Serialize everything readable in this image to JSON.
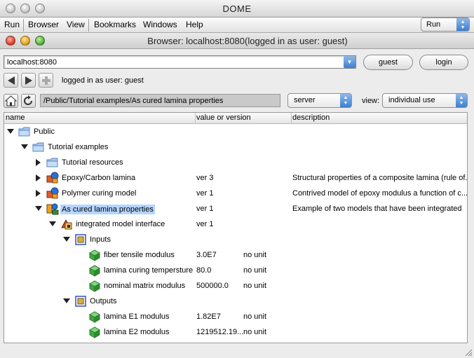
{
  "app": {
    "title": "DOME",
    "menu": [
      "Run",
      "Browser",
      "View",
      "Bookmarks",
      "Windows",
      "Help"
    ],
    "run_select": "Run"
  },
  "browser": {
    "title": "Browser: localhost:8080(logged in as user: guest)",
    "url": "localhost:8080",
    "user_button": "guest",
    "login_button": "login",
    "status": "logged in as user: guest",
    "path": "/Public/Tutorial examples/As cured lamina properties",
    "server_select": "server",
    "view_label": "view:",
    "view_select": "individual use"
  },
  "table": {
    "headers": {
      "name": "name",
      "value": "value or version",
      "description": "description"
    },
    "rows": [
      {
        "name": "Public",
        "value": "",
        "unit": "",
        "description": "",
        "icon": "folder-icon",
        "toggle": "expanded"
      },
      {
        "name": "Tutorial examples",
        "value": "",
        "unit": "",
        "description": "",
        "icon": "folder-icon",
        "toggle": "expanded"
      },
      {
        "name": "Tutorial resources",
        "value": "",
        "unit": "",
        "description": "",
        "icon": "folder-icon",
        "toggle": "collapsed"
      },
      {
        "name": "Epoxy/Carbon lamina",
        "value": "ver 3",
        "unit": "",
        "description": "Structural properties of a composite lamina (rule of...",
        "icon": "model-icon",
        "toggle": "collapsed"
      },
      {
        "name": "Polymer curing model",
        "value": "ver 1",
        "unit": "",
        "description": "Contrived model  of epoxy modulus a function of c...",
        "icon": "model-icon",
        "toggle": "collapsed"
      },
      {
        "name": "As cured lamina properties",
        "value": "ver 1",
        "unit": "",
        "description": "Example of two models that have been integrated",
        "icon": "integrated-model-icon",
        "toggle": "expanded",
        "selected": true
      },
      {
        "name": "integrated model interface",
        "value": "ver 1",
        "unit": "",
        "description": "",
        "icon": "interface-icon",
        "toggle": "expanded"
      },
      {
        "name": "Inputs",
        "value": "",
        "unit": "",
        "description": "",
        "icon": "inputs-group-icon",
        "toggle": "expanded"
      },
      {
        "name": "fiber tensile modulus",
        "value": "3.0E7",
        "unit": "no unit",
        "description": "",
        "icon": "parameter-cube-icon",
        "toggle": "none"
      },
      {
        "name": "lamina curing tempersture",
        "value": "80.0",
        "unit": "no unit",
        "description": "",
        "icon": "parameter-cube-icon",
        "toggle": "none"
      },
      {
        "name": "nominal matrix modulus",
        "value": "500000.0",
        "unit": "no unit",
        "description": "",
        "icon": "parameter-cube-icon",
        "toggle": "none"
      },
      {
        "name": "Outputs",
        "value": "",
        "unit": "",
        "description": "",
        "icon": "outputs-group-icon",
        "toggle": "expanded"
      },
      {
        "name": "lamina E1 modulus",
        "value": "1.82E7",
        "unit": "no unit",
        "description": "",
        "icon": "parameter-cube-icon",
        "toggle": "none"
      },
      {
        "name": "lamina E2 modulus",
        "value": "1219512.19...",
        "unit": "no unit",
        "description": "",
        "icon": "parameter-cube-icon",
        "toggle": "none"
      }
    ]
  }
}
